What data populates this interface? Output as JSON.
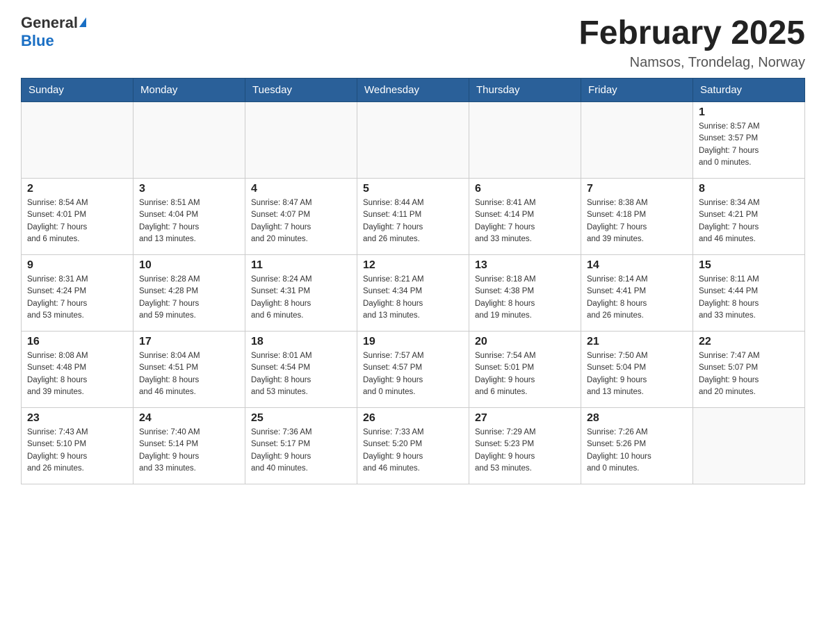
{
  "logo": {
    "general": "General",
    "blue": "Blue"
  },
  "title": "February 2025",
  "location": "Namsos, Trondelag, Norway",
  "days_of_week": [
    "Sunday",
    "Monday",
    "Tuesday",
    "Wednesday",
    "Thursday",
    "Friday",
    "Saturday"
  ],
  "weeks": [
    [
      {
        "day": "",
        "info": ""
      },
      {
        "day": "",
        "info": ""
      },
      {
        "day": "",
        "info": ""
      },
      {
        "day": "",
        "info": ""
      },
      {
        "day": "",
        "info": ""
      },
      {
        "day": "",
        "info": ""
      },
      {
        "day": "1",
        "info": "Sunrise: 8:57 AM\nSunset: 3:57 PM\nDaylight: 7 hours\nand 0 minutes."
      }
    ],
    [
      {
        "day": "2",
        "info": "Sunrise: 8:54 AM\nSunset: 4:01 PM\nDaylight: 7 hours\nand 6 minutes."
      },
      {
        "day": "3",
        "info": "Sunrise: 8:51 AM\nSunset: 4:04 PM\nDaylight: 7 hours\nand 13 minutes."
      },
      {
        "day": "4",
        "info": "Sunrise: 8:47 AM\nSunset: 4:07 PM\nDaylight: 7 hours\nand 20 minutes."
      },
      {
        "day": "5",
        "info": "Sunrise: 8:44 AM\nSunset: 4:11 PM\nDaylight: 7 hours\nand 26 minutes."
      },
      {
        "day": "6",
        "info": "Sunrise: 8:41 AM\nSunset: 4:14 PM\nDaylight: 7 hours\nand 33 minutes."
      },
      {
        "day": "7",
        "info": "Sunrise: 8:38 AM\nSunset: 4:18 PM\nDaylight: 7 hours\nand 39 minutes."
      },
      {
        "day": "8",
        "info": "Sunrise: 8:34 AM\nSunset: 4:21 PM\nDaylight: 7 hours\nand 46 minutes."
      }
    ],
    [
      {
        "day": "9",
        "info": "Sunrise: 8:31 AM\nSunset: 4:24 PM\nDaylight: 7 hours\nand 53 minutes."
      },
      {
        "day": "10",
        "info": "Sunrise: 8:28 AM\nSunset: 4:28 PM\nDaylight: 7 hours\nand 59 minutes."
      },
      {
        "day": "11",
        "info": "Sunrise: 8:24 AM\nSunset: 4:31 PM\nDaylight: 8 hours\nand 6 minutes."
      },
      {
        "day": "12",
        "info": "Sunrise: 8:21 AM\nSunset: 4:34 PM\nDaylight: 8 hours\nand 13 minutes."
      },
      {
        "day": "13",
        "info": "Sunrise: 8:18 AM\nSunset: 4:38 PM\nDaylight: 8 hours\nand 19 minutes."
      },
      {
        "day": "14",
        "info": "Sunrise: 8:14 AM\nSunset: 4:41 PM\nDaylight: 8 hours\nand 26 minutes."
      },
      {
        "day": "15",
        "info": "Sunrise: 8:11 AM\nSunset: 4:44 PM\nDaylight: 8 hours\nand 33 minutes."
      }
    ],
    [
      {
        "day": "16",
        "info": "Sunrise: 8:08 AM\nSunset: 4:48 PM\nDaylight: 8 hours\nand 39 minutes."
      },
      {
        "day": "17",
        "info": "Sunrise: 8:04 AM\nSunset: 4:51 PM\nDaylight: 8 hours\nand 46 minutes."
      },
      {
        "day": "18",
        "info": "Sunrise: 8:01 AM\nSunset: 4:54 PM\nDaylight: 8 hours\nand 53 minutes."
      },
      {
        "day": "19",
        "info": "Sunrise: 7:57 AM\nSunset: 4:57 PM\nDaylight: 9 hours\nand 0 minutes."
      },
      {
        "day": "20",
        "info": "Sunrise: 7:54 AM\nSunset: 5:01 PM\nDaylight: 9 hours\nand 6 minutes."
      },
      {
        "day": "21",
        "info": "Sunrise: 7:50 AM\nSunset: 5:04 PM\nDaylight: 9 hours\nand 13 minutes."
      },
      {
        "day": "22",
        "info": "Sunrise: 7:47 AM\nSunset: 5:07 PM\nDaylight: 9 hours\nand 20 minutes."
      }
    ],
    [
      {
        "day": "23",
        "info": "Sunrise: 7:43 AM\nSunset: 5:10 PM\nDaylight: 9 hours\nand 26 minutes."
      },
      {
        "day": "24",
        "info": "Sunrise: 7:40 AM\nSunset: 5:14 PM\nDaylight: 9 hours\nand 33 minutes."
      },
      {
        "day": "25",
        "info": "Sunrise: 7:36 AM\nSunset: 5:17 PM\nDaylight: 9 hours\nand 40 minutes."
      },
      {
        "day": "26",
        "info": "Sunrise: 7:33 AM\nSunset: 5:20 PM\nDaylight: 9 hours\nand 46 minutes."
      },
      {
        "day": "27",
        "info": "Sunrise: 7:29 AM\nSunset: 5:23 PM\nDaylight: 9 hours\nand 53 minutes."
      },
      {
        "day": "28",
        "info": "Sunrise: 7:26 AM\nSunset: 5:26 PM\nDaylight: 10 hours\nand 0 minutes."
      },
      {
        "day": "",
        "info": ""
      }
    ]
  ]
}
